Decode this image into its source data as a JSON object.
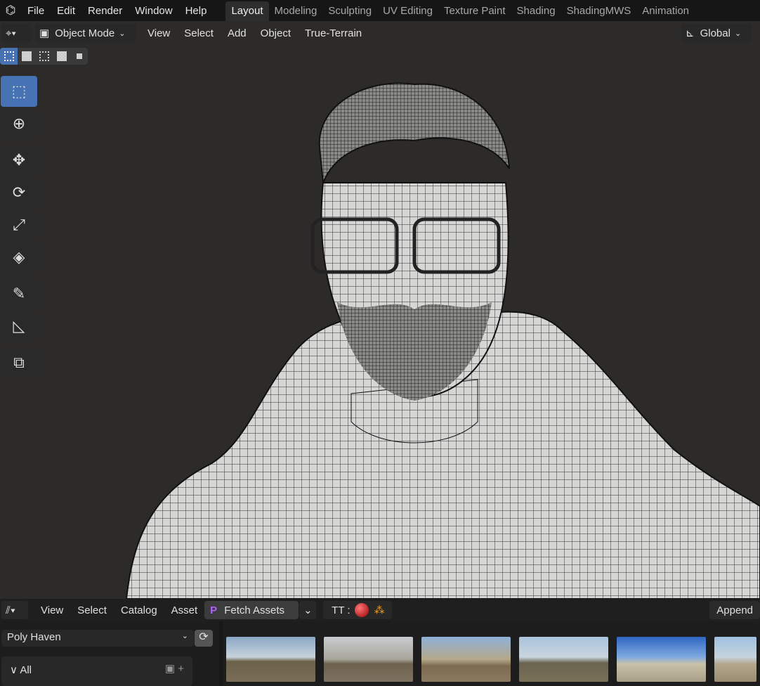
{
  "topbar": {
    "menus": [
      "File",
      "Edit",
      "Render",
      "Window",
      "Help"
    ],
    "tabs": [
      "Layout",
      "Modeling",
      "Sculpting",
      "UV Editing",
      "Texture Paint",
      "Shading",
      "ShadingMWS",
      "Animation"
    ],
    "active_tab": "Layout"
  },
  "viewport_header": {
    "mode": "Object Mode",
    "menus": [
      "View",
      "Select",
      "Add",
      "Object",
      "True-Terrain"
    ],
    "orientation": "Global"
  },
  "toolbar": {
    "tools": [
      "select-box",
      "cursor",
      "move",
      "rotate",
      "scale",
      "transform",
      "annotate",
      "measure",
      "add-cube"
    ]
  },
  "asset_browser": {
    "menus": [
      "View",
      "Select",
      "Catalog",
      "Asset"
    ],
    "fetch_label": "Fetch Assets",
    "tt_label": "TT :",
    "append_label": "Append",
    "library": "Poly Haven",
    "catalog_all": "All",
    "thumbnails": [
      "hdri-1",
      "hdri-2",
      "hdri-3",
      "hdri-4",
      "hdri-5",
      "hdri-6"
    ]
  },
  "colors": {
    "accent": "#4772b3",
    "viewport_bg": "#2d2b29"
  }
}
